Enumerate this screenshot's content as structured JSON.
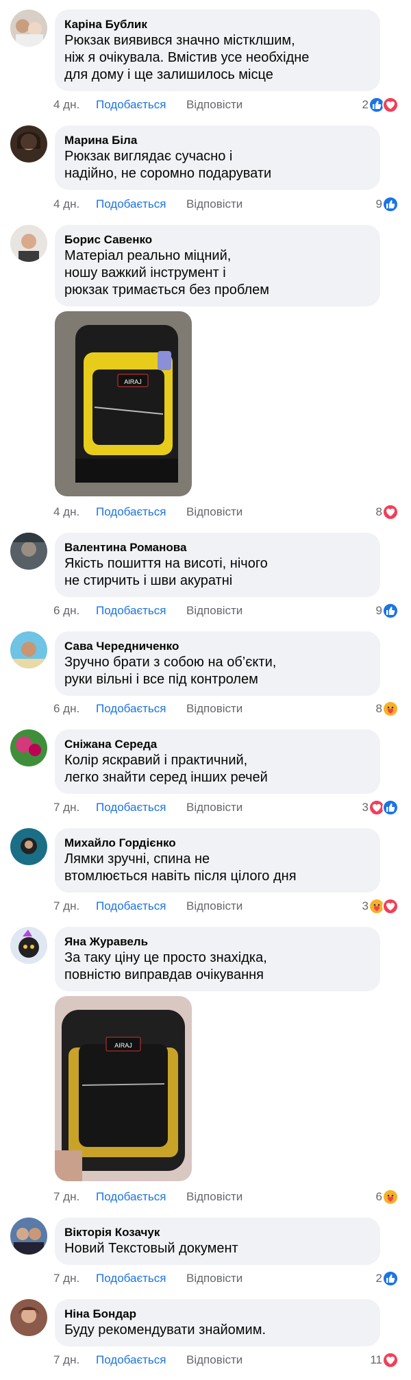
{
  "actions": {
    "like": "Подобається",
    "reply": "Відповісти"
  },
  "comments": [
    {
      "author": "Каріна Бублик",
      "text": "Рюкзак виявився значно містклшим,\nніж я очікувала. Вмістив усе необхідне\nдля дому і ще залишилось місце",
      "time": "4 дн.",
      "count": "2",
      "reactions": [
        "like-icon",
        "love-icon"
      ]
    },
    {
      "author": "Марина Біла",
      "text": "Рюкзак виглядає сучасно і\nнадійно, не соромно подарувати",
      "time": "4 дн.",
      "count": "9",
      "reactions": [
        "like-icon"
      ]
    },
    {
      "author": "Борис Савенко",
      "text": "Матеріал реально міцний,\nношу важкий інструмент і\nрюкзак тримається без проблем",
      "time": "4 дн.",
      "count": "8",
      "reactions": [
        "love-icon"
      ],
      "photo_brand": "AIRAJ"
    },
    {
      "author": "Валентина Романова",
      "text": "Якість пошиття на висоті, нічого\nне стирчить і шви акуратні",
      "time": "6 дн.",
      "count": "9",
      "reactions": [
        "like-icon"
      ]
    },
    {
      "author": "Сава Чередниченко",
      "text": "Зручно брати з собою на об’єкти,\nруки вільні і все під контролем",
      "time": "6 дн.",
      "count": "8",
      "reactions": [
        "care-icon"
      ]
    },
    {
      "author": "Сніжана Середа",
      "text": "Колір яскравий і практичний,\nлегко знайти серед інших речей",
      "time": "7 дн.",
      "count": "3",
      "reactions": [
        "love-icon",
        "like-icon"
      ]
    },
    {
      "author": "Михайло Гордієнко",
      "text": "Лямки зручні, спина не\nвтомлюється навіть після цілого дня",
      "time": "7 дн.",
      "count": "3",
      "reactions": [
        "care-icon",
        "love-icon"
      ]
    },
    {
      "author": "Яна Журавель",
      "text": "За таку ціну це просто знахідка,\nповністю виправдав очікування",
      "time": "7 дн.",
      "count": "6",
      "reactions": [
        "care-icon"
      ],
      "photo_brand": "AIRAJ"
    },
    {
      "author": "Вікторія Козачук",
      "text": "Новий Текстовый документ",
      "time": "7 дн.",
      "count": "2",
      "reactions": [
        "like-icon"
      ]
    },
    {
      "author": "Ніна Бондар",
      "text": "Буду рекомендувати знайомим.",
      "time": "7 дн.",
      "count": "11",
      "reactions": [
        "love-icon"
      ]
    }
  ],
  "colors": {
    "like": "#1b74e4",
    "love": "#f33e58",
    "care": "#f7b125",
    "bubble": "#f0f2f5",
    "meta": "#65676b"
  }
}
